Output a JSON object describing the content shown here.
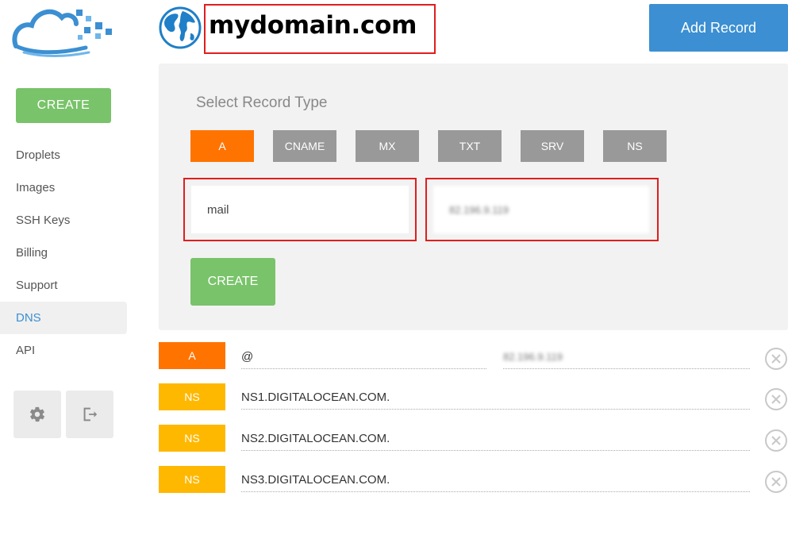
{
  "brand": {
    "logo_icon": "cloud-logo-icon"
  },
  "sidebar": {
    "create_label": "CREATE",
    "items": [
      {
        "label": "Droplets",
        "active": false
      },
      {
        "label": "Images",
        "active": false
      },
      {
        "label": "SSH Keys",
        "active": false
      },
      {
        "label": "Billing",
        "active": false
      },
      {
        "label": "Support",
        "active": false
      },
      {
        "label": "DNS",
        "active": true
      },
      {
        "label": "API",
        "active": false
      }
    ],
    "bottom_buttons": [
      {
        "icon": "gear-icon"
      },
      {
        "icon": "logout-icon"
      }
    ]
  },
  "header": {
    "icon": "globe-icon",
    "domain": "mydomain.com",
    "add_record_label": "Add Record"
  },
  "form": {
    "title": "Select Record Type",
    "record_types": [
      {
        "label": "A",
        "active": true
      },
      {
        "label": "CNAME",
        "active": false
      },
      {
        "label": "MX",
        "active": false
      },
      {
        "label": "TXT",
        "active": false
      },
      {
        "label": "SRV",
        "active": false
      },
      {
        "label": "NS",
        "active": false
      }
    ],
    "hostname_value": "mail",
    "ip_value": "82.196.9.119",
    "create_label": "CREATE"
  },
  "records": [
    {
      "type": "A",
      "name": "@",
      "value": "82.196.9.119"
    },
    {
      "type": "NS",
      "name": "NS1.DIGITALOCEAN.COM.",
      "value": ""
    },
    {
      "type": "NS",
      "name": "NS2.DIGITALOCEAN.COM.",
      "value": ""
    },
    {
      "type": "NS",
      "name": "NS3.DIGITALOCEAN.COM.",
      "value": ""
    }
  ],
  "colors": {
    "accent_blue": "#3b8fd2",
    "create_green": "#79c36a",
    "type_a_orange": "#ff7300",
    "type_ns_yellow": "#ffb800",
    "highlight_red": "#e01e1e"
  }
}
